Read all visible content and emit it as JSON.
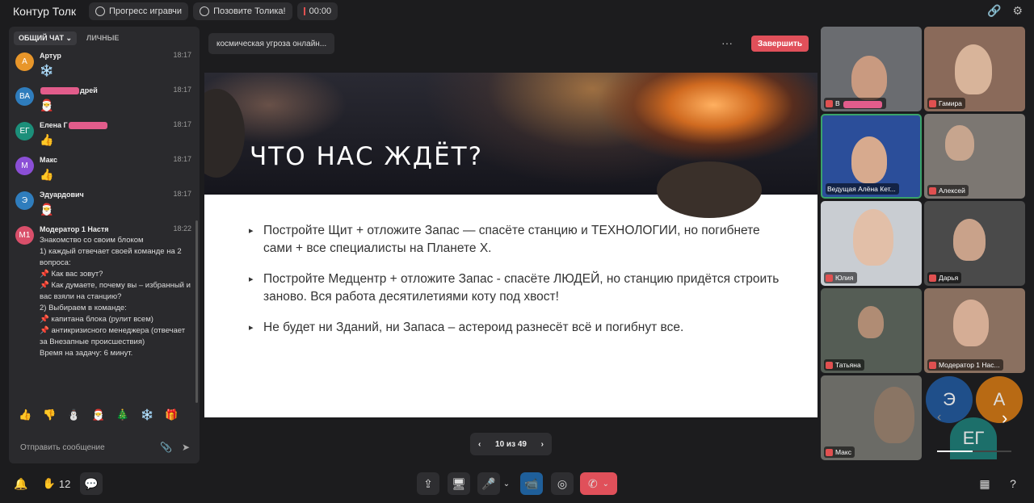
{
  "app": {
    "title": "Контур Толк"
  },
  "top": {
    "progress_label": "Прогресс игравчи",
    "call_label": "Позовите Толика!",
    "timer": "00:00"
  },
  "chat": {
    "tabs": [
      {
        "label": "ОБЩИЙ ЧАТ",
        "chevron": "⌄"
      },
      {
        "label": "ЛИЧНЫЕ"
      }
    ],
    "messages": [
      {
        "initials": "А",
        "color": "#e8962a",
        "name": "Артур",
        "time": "18:17",
        "content": "❄️"
      },
      {
        "initials": "ВА",
        "color": "#2f7dbd",
        "name_suffix": "дрей",
        "time": "18:17",
        "content": "🎅"
      },
      {
        "initials": "ЕГ",
        "color": "#1c8f7a",
        "name": "Елена Г",
        "time": "18:17",
        "content": "👍"
      },
      {
        "initials": "М",
        "color": "#8b4fd6",
        "name": "Макс",
        "time": "18:17",
        "content": "👍"
      },
      {
        "initials": "Э",
        "color": "#2f7dbd",
        "name": "Эдуардович",
        "time": "18:17",
        "content": "🎅"
      }
    ],
    "moderator": {
      "initials": "М1",
      "color": "#d94f6a",
      "name": "Модератор 1 Настя",
      "time": "18:22",
      "text": "Знакомство со своим блоком\n1) каждый отвечает своей команде на 2 вопроса:\n📌 Как вас зовут?\n📌 Как думаете, почему вы – избранный и вас взяли на станцию?\n2) Выбираем в команде:\n📌 капитана блока (рулит всем)\n📌 антикризисного менеджера (отвечает за Внезапные происшествия)\nВремя на задачу: 6 минут."
    },
    "reactions": [
      "👍",
      "👎",
      "⛄",
      "🎅",
      "🎄",
      "❄️",
      "🎁"
    ],
    "input_placeholder": "Отправить сообщение"
  },
  "main": {
    "presentation_name": "космическая угроза онлайн...",
    "more": "···",
    "finish_label": "Завершить",
    "slide_title": "ЧТО НАС ЖДЁТ?",
    "bullets": [
      "Постройте Щит + отложите Запас — спасёте станцию и ТЕХНОЛОГИИ, но погибнете сами + все специалисты на Планете Х.",
      "Постройте Медцентр + отложите Запас - спасёте ЛЮДЕЙ, но станцию придётся строить заново. Вся работа десятилетиями коту под хвост!",
      "Не будет ни Зданий, ни Запаса – астероид разнесёт всё и погибнут все."
    ],
    "pager": {
      "text": "10 из 49",
      "prev": "‹",
      "next": "›"
    }
  },
  "participants": [
    {
      "name": "В",
      "color": "#6a6c70"
    },
    {
      "name": "Гамира",
      "color": "#8a6a5a"
    },
    {
      "name": "Ведущая Алёна Кет...",
      "color": "#2b4e9a"
    },
    {
      "name": "Алексей",
      "color": "#7c7772"
    },
    {
      "name": "Юлия",
      "color": "#c9cdd2"
    },
    {
      "name": "Дарья",
      "color": "#4a4a4a"
    },
    {
      "name": "Татьяна",
      "color": "#555d55"
    },
    {
      "name": "Модератор 1 Нас...",
      "color": "#8a7060"
    },
    {
      "name": "Макс",
      "color": "#6b6b66"
    }
  ],
  "avatar_badges": [
    {
      "initials": "Э",
      "color": "#1f4f8a"
    },
    {
      "initials": "А",
      "color": "#b86a14"
    },
    {
      "initials": "ЕГ",
      "color": "#1c6f6a"
    }
  ],
  "bottom": {
    "hand_count": "12"
  }
}
